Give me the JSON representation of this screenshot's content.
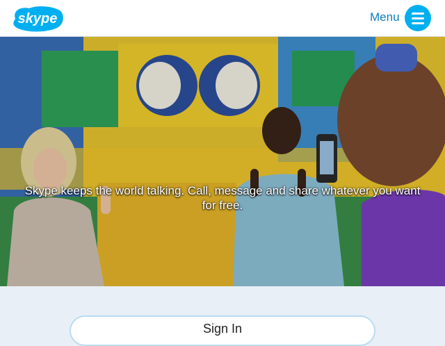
{
  "header": {
    "logo_text": "skype",
    "menu_label": "Menu",
    "menu_icon": "hamburger-icon"
  },
  "hero": {
    "tagline": "Skype keeps the world talking. Call, message and share whatever you want for free.",
    "image": "photo of three people in front of a colorful graffiti wall, one taking a phone picture"
  },
  "signin": {
    "label": "Sign In"
  },
  "colors": {
    "brand_blue": "#00aff0",
    "link_blue": "#0a7dc2",
    "page_bg": "#e8eff6"
  }
}
